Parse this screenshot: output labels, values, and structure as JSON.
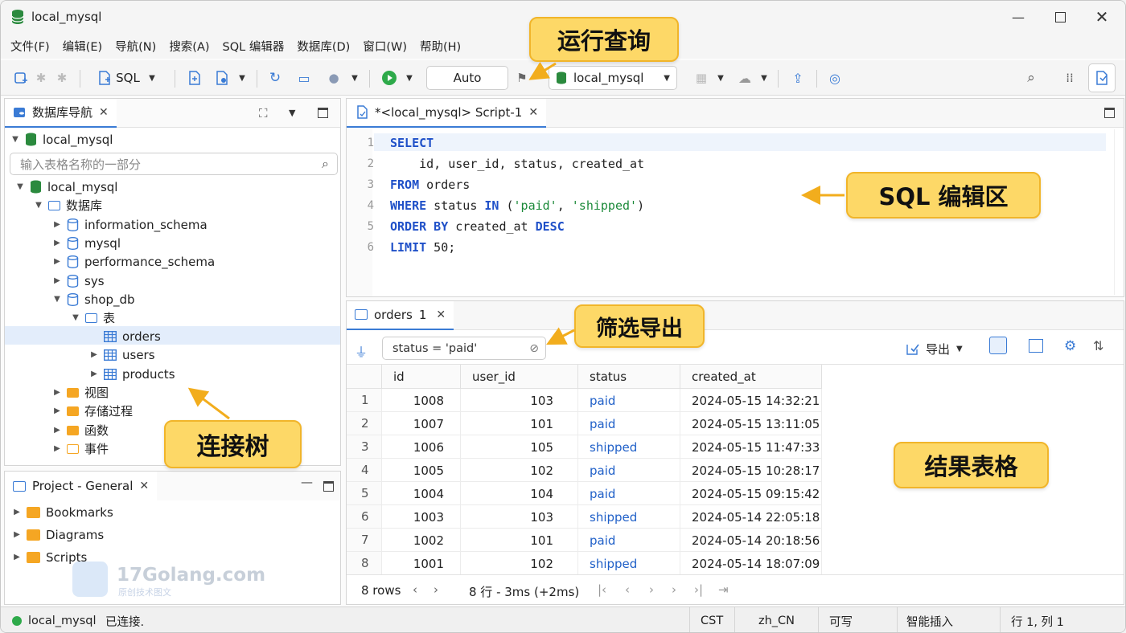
{
  "window": {
    "title": "local_mysql"
  },
  "menu": [
    "文件(F)",
    "编辑(E)",
    "导航(N)",
    "搜索(A)",
    "SQL 编辑器",
    "数据库(D)",
    "窗口(W)",
    "帮助(H)"
  ],
  "toolbar": {
    "sql_label": "SQL",
    "commit_mode": "Auto",
    "connection": "local_mysql"
  },
  "navigator": {
    "tab_label": "数据库导航",
    "root": "local_mysql",
    "filter_placeholder": "输入表格名称的一部分",
    "tree": {
      "connection": "local_mysql",
      "databases_folder": "数据库",
      "schemas": [
        "information_schema",
        "mysql",
        "performance_schema",
        "sys",
        "shop_db"
      ],
      "tables_folder": "表",
      "tables": [
        "orders",
        "users",
        "products"
      ],
      "folders": [
        "视图",
        "存储过程",
        "函数",
        "事件"
      ]
    }
  },
  "project": {
    "tab_label": "Project - General",
    "items": [
      "Bookmarks",
      "Diagrams",
      "Scripts"
    ]
  },
  "watermark": {
    "brand": "17Golang.com",
    "sub": "原创技术图文"
  },
  "editor": {
    "tab_label": "*<local_mysql> Script-1",
    "lines": [
      {
        "n": "1",
        "t": [
          {
            "k": "kw",
            "v": "SELECT"
          }
        ]
      },
      {
        "n": "2",
        "t": [
          {
            "k": "",
            "v": "    id, user_id, status, created_at"
          }
        ]
      },
      {
        "n": "3",
        "t": [
          {
            "k": "kw",
            "v": "FROM"
          },
          {
            "k": "",
            "v": " orders"
          }
        ]
      },
      {
        "n": "4",
        "t": [
          {
            "k": "kw",
            "v": "WHERE"
          },
          {
            "k": "",
            "v": " status "
          },
          {
            "k": "kw",
            "v": "IN"
          },
          {
            "k": "",
            "v": " ("
          },
          {
            "k": "str",
            "v": "'paid'"
          },
          {
            "k": "",
            "v": ", "
          },
          {
            "k": "str",
            "v": "'shipped'"
          },
          {
            "k": "",
            "v": ")"
          }
        ]
      },
      {
        "n": "5",
        "t": [
          {
            "k": "kw",
            "v": "ORDER BY"
          },
          {
            "k": "",
            "v": " created_at "
          },
          {
            "k": "kw",
            "v": "DESC"
          }
        ]
      },
      {
        "n": "6",
        "t": [
          {
            "k": "kw",
            "v": "LIMIT"
          },
          {
            "k": "",
            "v": " 50;"
          }
        ]
      }
    ]
  },
  "results": {
    "tab_label": "orders",
    "tab_count": "1",
    "filter_value": "status = 'paid'",
    "export_label": "导出",
    "columns": [
      "id",
      "user_id",
      "status",
      "created_at"
    ],
    "rows": [
      [
        "1",
        "1008",
        "103",
        "paid",
        "2024-05-15 14:32:21"
      ],
      [
        "2",
        "1007",
        "101",
        "paid",
        "2024-05-15 13:11:05"
      ],
      [
        "3",
        "1006",
        "105",
        "shipped",
        "2024-05-15 11:47:33"
      ],
      [
        "4",
        "1005",
        "102",
        "paid",
        "2024-05-15 10:28:17"
      ],
      [
        "5",
        "1004",
        "104",
        "paid",
        "2024-05-15 09:15:42"
      ],
      [
        "6",
        "1003",
        "103",
        "shipped",
        "2024-05-14 22:05:18"
      ],
      [
        "7",
        "1002",
        "101",
        "paid",
        "2024-05-14 20:18:56"
      ],
      [
        "8",
        "1001",
        "102",
        "shipped",
        "2024-05-14 18:07:09"
      ]
    ],
    "row_count": "8 rows",
    "timing": "8 行 - 3ms (+2ms)"
  },
  "callouts": {
    "run": "运行查询",
    "editor": "SQL 编辑区",
    "filter": "筛选导出",
    "tree": "连接树",
    "grid": "结果表格"
  },
  "statusbar": {
    "connection": "local_mysql",
    "state": "已连接.",
    "tz": "CST",
    "locale": "zh_CN",
    "mode": "可写",
    "insert": "智能插入",
    "position": "行 1, 列 1"
  },
  "colors": {
    "accent": "#3a7bd5",
    "keyword": "#1f50c8",
    "string": "#1c8a3a",
    "status_text": "#2060c8",
    "callout": "#fdd867",
    "connected": "#2eaa4a"
  }
}
